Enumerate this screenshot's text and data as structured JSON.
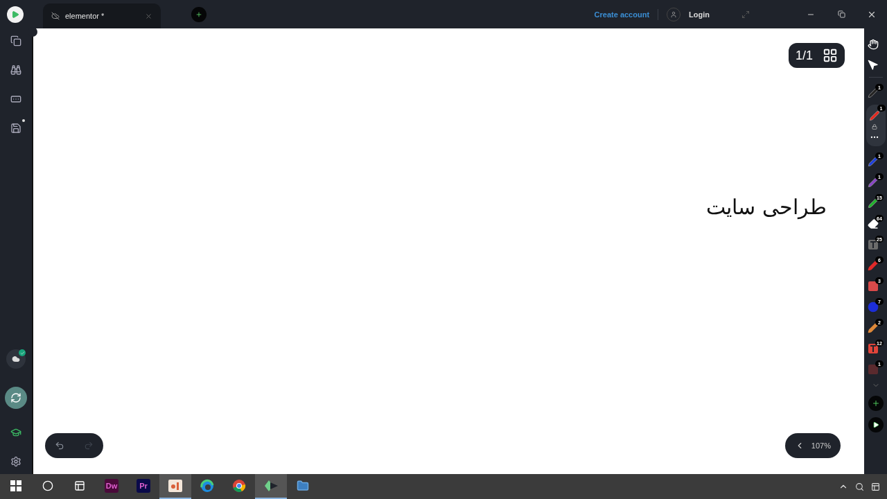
{
  "titlebar": {
    "tab": {
      "title": "elementor *"
    },
    "create_account": "Create account",
    "login": "Login"
  },
  "sidebar": {
    "items": [
      {
        "kind": "pages"
      },
      {
        "kind": "find"
      },
      {
        "kind": "input"
      },
      {
        "kind": "save"
      }
    ],
    "cloud_synced": true
  },
  "canvas": {
    "page_counter": "1/1",
    "ink_text": "طراحی سایت",
    "undo": {
      "disabled": false
    },
    "redo": {
      "disabled": true
    },
    "zoom": "107%"
  },
  "tools": [
    {
      "kind": "hand",
      "selected": false
    },
    {
      "kind": "pointer",
      "selected": false
    },
    {
      "kind": "pen",
      "color": "#222222",
      "badge": "1",
      "selected": false
    },
    {
      "kind": "pen",
      "color": "#e8261c",
      "badge": "1",
      "selected": true
    },
    {
      "kind": "pen",
      "color": "#1c3fe0",
      "badge": "1",
      "selected": false
    },
    {
      "kind": "pen",
      "color": "#8a44c8",
      "badge": "1",
      "selected": false
    },
    {
      "kind": "pen",
      "color": "#1fb52a",
      "badge": "15",
      "selected": false
    },
    {
      "kind": "eraser",
      "color": "#ffffff",
      "badge": "64",
      "selected": false
    },
    {
      "kind": "text",
      "color": "#6b6b6b",
      "badge": "25",
      "selected": false
    },
    {
      "kind": "marker",
      "color": "#e02a2a",
      "badge": "6",
      "selected": false
    },
    {
      "kind": "rect",
      "color": "#d94a4a",
      "badge": "3",
      "selected": false
    },
    {
      "kind": "circle",
      "color": "#1c2ed8",
      "badge": "7",
      "selected": false
    },
    {
      "kind": "marker",
      "color": "#e08a3a",
      "badge": "2",
      "selected": false
    },
    {
      "kind": "text",
      "color": "#e0443a",
      "badge": "12",
      "selected": false
    },
    {
      "kind": "rect",
      "color": "#5a2a2e",
      "badge": "1",
      "selected": false
    }
  ],
  "taskbar": [
    {
      "kind": "start",
      "active": false
    },
    {
      "kind": "search",
      "active": false
    },
    {
      "kind": "taskview",
      "active": false
    },
    {
      "kind": "label",
      "label": "Dw",
      "color": "#4a0a3a",
      "active": false
    },
    {
      "kind": "label",
      "label": "Pr",
      "color": "#0a0a4a",
      "active": false
    },
    {
      "kind": "slides",
      "active": true
    },
    {
      "kind": "edge",
      "active": false
    },
    {
      "kind": "chrome",
      "active": false
    },
    {
      "kind": "app",
      "active": true
    },
    {
      "kind": "files",
      "active": false
    }
  ]
}
